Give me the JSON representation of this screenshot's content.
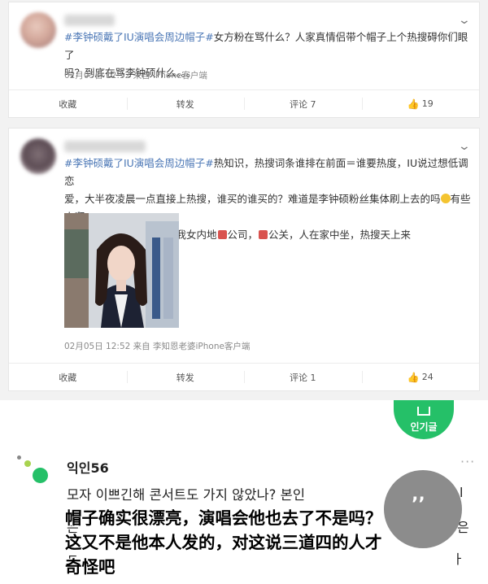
{
  "posts": [
    {
      "hashtag": "#李钟硕戴了IU演唱会周边帽子#",
      "text_line1_rest": "女方粉在骂什么？人家真情侣带个帽子上个热搜碍你们眼了",
      "text_line2": "吗？到底在骂李钟硕什么。。。",
      "meta": "02月05日 12:52  来自 iPhone客户端",
      "actions": {
        "collect": "收藏",
        "repost": "转发",
        "comment": "评论 7",
        "like": "19"
      }
    },
    {
      "hashtag": "#李钟硕戴了IU演唱会周边帽子#",
      "text_line1_rest": "热知识，热搜词条谁排在前面＝谁要热度，IU说过想低调恋",
      "text_line2a": "爱，大半夜凌晨一点直接上热搜，谁买的谁买的？难道是李钟硕粉丝集体刷上去的吗",
      "text_line2b": "有些人啊",
      "text_line3a": "别得了便宜还卖乖，反正我女内地",
      "text_line3b": "公司，",
      "text_line3c": "公关，人在家中坐，热搜天上来",
      "meta": "02月05日 12:52  来自 李知恩老婆iPhone客户端",
      "actions": {
        "collect": "收藏",
        "repost": "转发",
        "comment": "评论 1",
        "like": "24"
      }
    }
  ],
  "kr": {
    "popular_label": "인기글",
    "username": "익인56",
    "line1": "모자 이쁘긴해 콘서트도 가지 않았나? 본인",
    "frag_right1": "l",
    "frag_left2": "은",
    "frag_right2": "은",
    "frag_left3": "ㄷ",
    "frag_right3": "ㅏ",
    "caption_line1": "帽子确实很漂亮，演唱会他也去了不是吗？",
    "caption_line2": "这又不是他本人发的，对这说三道四的人才",
    "caption_line3": "奇怪吧"
  },
  "colors": {
    "hashtag": "#4a76b5",
    "popular": "#25c068"
  }
}
